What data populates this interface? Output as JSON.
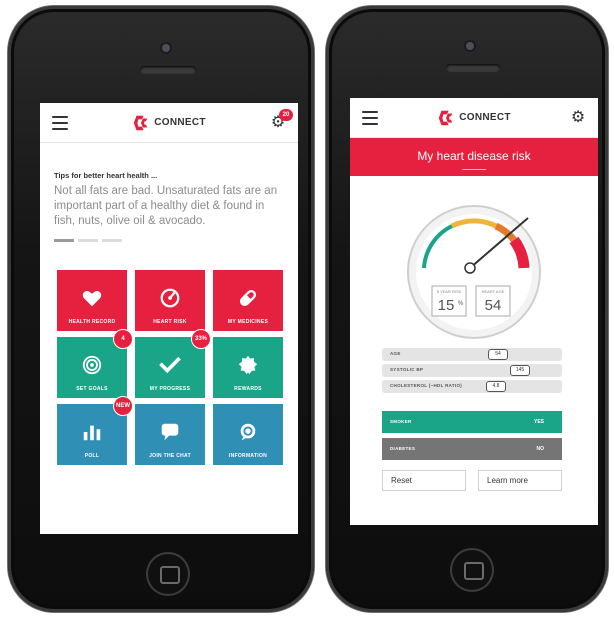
{
  "left_phone": {
    "brand": "CONNECT",
    "gear_badge": "20",
    "tips": {
      "title": "Tips for better heart health ...",
      "body": "Not all fats are bad. Unsaturated fats are an important part of a healthy diet & found in fish, nuts, olive oil & avocado."
    },
    "tiles": [
      {
        "label": "HEALTH RECORD",
        "icon": "heart-icon",
        "color": "#e6213f"
      },
      {
        "label": "HEART RISK",
        "icon": "gauge-icon",
        "color": "#e6213f"
      },
      {
        "label": "MY MEDICINES",
        "icon": "pill-icon",
        "color": "#e6213f"
      },
      {
        "label": "SET GOALS",
        "icon": "target-icon",
        "color": "#1aa588",
        "badge": "4"
      },
      {
        "label": "MY PROGRESS",
        "icon": "check-icon",
        "color": "#1aa588",
        "badge": "33%"
      },
      {
        "label": "REWARDS",
        "icon": "badge-icon",
        "color": "#1aa588"
      },
      {
        "label": "POLL",
        "icon": "bar-chart-icon",
        "color": "#2f8fb4",
        "badge": "NEW"
      },
      {
        "label": "JOIN THE CHAT",
        "icon": "chat-icon",
        "color": "#2f8fb4"
      },
      {
        "label": "INFORMATION",
        "icon": "info-icon",
        "color": "#2f8fb4"
      }
    ]
  },
  "right_phone": {
    "brand": "CONNECT",
    "title": "My heart disease risk",
    "gauge": {
      "five_year_label": "5 YEAR RISK",
      "five_year_value": "15",
      "five_year_unit": "%",
      "heart_age_label": "HEART AGE",
      "heart_age_value": "54"
    },
    "metrics": [
      {
        "label": "AGE",
        "value": "54"
      },
      {
        "label": "SYSTOLIC BP",
        "value": "145"
      },
      {
        "label": "CHOLESTEROL (~HDL RATIO)",
        "value": "4.8"
      }
    ],
    "toggles": {
      "smoker": {
        "label": "SMOKER",
        "value": "YES"
      },
      "diabetes": {
        "label": "DIABETES",
        "value": "NO"
      }
    },
    "buttons": {
      "reset": "Reset",
      "learn_more": "Learn more"
    }
  }
}
